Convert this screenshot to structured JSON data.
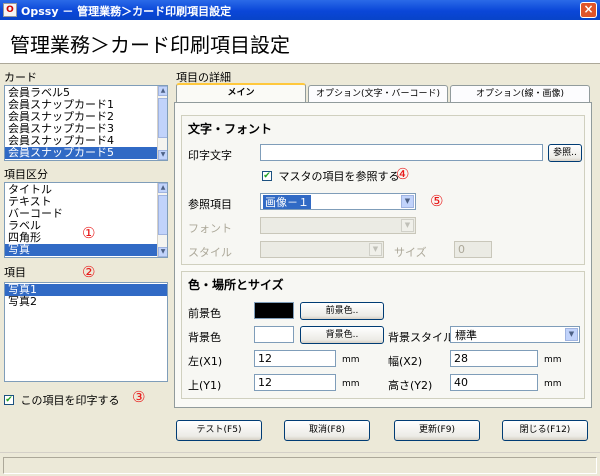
{
  "window": {
    "title": "Opssy － 管理業務＞カード印刷項目設定",
    "close": "×",
    "app_icon": "O"
  },
  "header": {
    "title": "管理業務＞カード印刷項目設定"
  },
  "card": {
    "label": "カード",
    "items": [
      "会員ラベル5",
      "会員スナップカード1",
      "会員スナップカード2",
      "会員スナップカード3",
      "会員スナップカード4",
      "会員スナップカード5"
    ],
    "selected_index": 5
  },
  "category": {
    "label": "項目区分",
    "items": [
      "タイトル",
      "テキスト",
      "バーコード",
      "ラベル",
      "四角形",
      "写真"
    ],
    "selected_index": 5
  },
  "item": {
    "label": "項目",
    "items": [
      "写真1",
      "写真2"
    ],
    "selected_index": 0
  },
  "print_checkbox": {
    "label": "この項目を印字する",
    "checked": true
  },
  "markers": {
    "m1": "①",
    "m2": "②",
    "m3": "③",
    "m4": "④",
    "m5": "⑤"
  },
  "details": {
    "label": "項目の詳細",
    "tabs": [
      {
        "label": "メイン",
        "active": true
      },
      {
        "label": "オプション(文字・バーコード)",
        "active": false
      },
      {
        "label": "オプション(線・画像)",
        "active": false
      }
    ]
  },
  "text_font": {
    "title": "文字・フォント",
    "print_text_label": "印字文字",
    "print_text_value": "",
    "browse_button": "参照..",
    "master_ref_checkbox": {
      "label": "マスタの項目を参照する",
      "checked": true
    },
    "ref_item_label": "参照項目",
    "ref_item_value": "画像－１",
    "font_label": "フォント",
    "font_value": "",
    "style_label": "スタイル",
    "style_value": "",
    "size_label": "サイズ",
    "size_value": "0"
  },
  "color_place": {
    "title": "色・場所とサイズ",
    "fg_label": "前景色",
    "fg_color": "#000000",
    "fg_button": "前景色..",
    "bg_label": "背景色",
    "bg_color": "#ffffff",
    "bg_button": "背景色..",
    "bg_style_label": "背景スタイル",
    "bg_style_value": "標準",
    "left_label": "左(X1)",
    "left_value": "12",
    "top_label": "上(Y1)",
    "top_value": "12",
    "width_label": "幅(X2)",
    "width_value": "28",
    "height_label": "高さ(Y2)",
    "height_value": "40",
    "unit": "mm"
  },
  "buttons": {
    "test": "テスト(F5)",
    "cancel": "取消(F8)",
    "update": "更新(F9)",
    "close": "閉じる(F12)"
  },
  "icons": {
    "checkmark": "✔",
    "dropdown": "▼",
    "scroll_up": "▲",
    "scroll_down": "▼"
  },
  "colors": {
    "selection": "#316ac5",
    "marker": "#e81818",
    "titlebar": "#0a46d8"
  }
}
